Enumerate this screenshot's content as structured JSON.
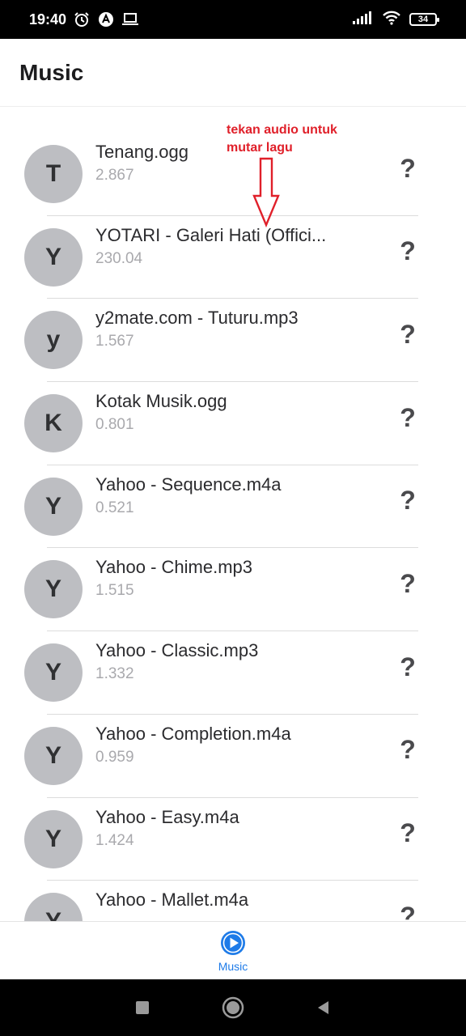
{
  "status_bar": {
    "time": "19:40",
    "battery": "34",
    "icons": [
      "alarm-icon",
      "app-a-icon",
      "laptop-icon",
      "signal-icon",
      "wifi-icon",
      "battery-icon"
    ]
  },
  "header": {
    "title": "Music"
  },
  "annotation": {
    "line1": "tekan audio untuk",
    "line2": "mutar lagu",
    "color": "#e0202a"
  },
  "list": {
    "help_glyph": "?",
    "items": [
      {
        "initial": "T",
        "title": "Tenang.ogg",
        "subtitle": "2.867"
      },
      {
        "initial": "Y",
        "title": "YOTARI - Galeri Hati (Offici...",
        "subtitle": "230.04"
      },
      {
        "initial": "y",
        "title": "y2mate.com - Tuturu.mp3",
        "subtitle": "1.567"
      },
      {
        "initial": "K",
        "title": "Kotak Musik.ogg",
        "subtitle": "0.801"
      },
      {
        "initial": "Y",
        "title": "Yahoo - Sequence.m4a",
        "subtitle": "0.521"
      },
      {
        "initial": "Y",
        "title": "Yahoo - Chime.mp3",
        "subtitle": "1.515"
      },
      {
        "initial": "Y",
        "title": "Yahoo - Classic.mp3",
        "subtitle": "1.332"
      },
      {
        "initial": "Y",
        "title": "Yahoo - Completion.m4a",
        "subtitle": "0.959"
      },
      {
        "initial": "Y",
        "title": "Yahoo - Easy.m4a",
        "subtitle": "1.424"
      },
      {
        "initial": "Y",
        "title": "Yahoo - Mallet.m4a",
        "subtitle": ""
      }
    ]
  },
  "tab_bar": {
    "active_label": "Music",
    "accent": "#1e7be8"
  },
  "nav_bar": {
    "buttons": [
      "recents-square-icon",
      "home-circle-icon",
      "back-triangle-icon"
    ]
  }
}
